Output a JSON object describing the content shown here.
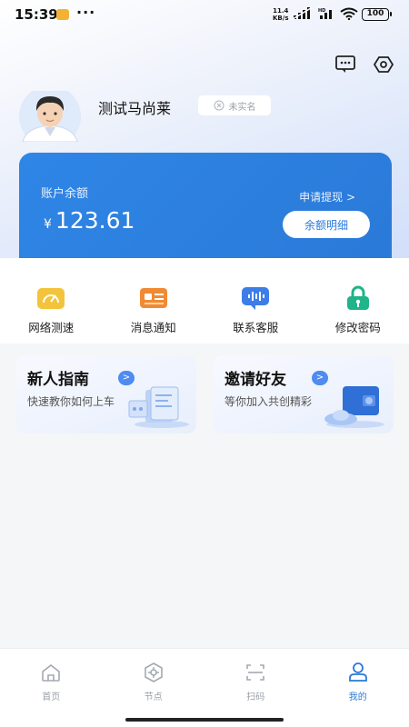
{
  "status_bar": {
    "time": "15:39",
    "network_speed_value": "11.4",
    "network_speed_unit": "KB/s",
    "battery": "100"
  },
  "profile": {
    "username": "测试马尚莱",
    "verify_status": "未实名"
  },
  "balance_card": {
    "label": "账户余额",
    "currency": "¥",
    "amount": "123.61",
    "withdraw_link": "申请提现 >",
    "detail_button": "余额明细",
    "color": "#2a79d8"
  },
  "quick_actions": [
    {
      "label": "网络测速",
      "icon": "speedometer-icon",
      "color": "#f3c43b"
    },
    {
      "label": "消息通知",
      "icon": "message-card-icon",
      "color": "#f08a33"
    },
    {
      "label": "联系客服",
      "icon": "voice-chat-icon",
      "color": "#3d7de8"
    },
    {
      "label": "修改密码",
      "icon": "lock-icon",
      "color": "#1fb48a"
    }
  ],
  "promo_cards": [
    {
      "title": "新人指南",
      "subtitle": "快速教你如何上车",
      "arrow": ">"
    },
    {
      "title": "邀请好友",
      "subtitle": "等你加入共创精彩",
      "arrow": ">"
    }
  ],
  "tab_bar": {
    "active": "我的",
    "items": [
      {
        "label": "首页",
        "icon": "home-icon"
      },
      {
        "label": "节点",
        "icon": "node-icon"
      },
      {
        "label": "扫码",
        "icon": "scan-icon"
      },
      {
        "label": "我的",
        "icon": "profile-icon"
      }
    ]
  }
}
